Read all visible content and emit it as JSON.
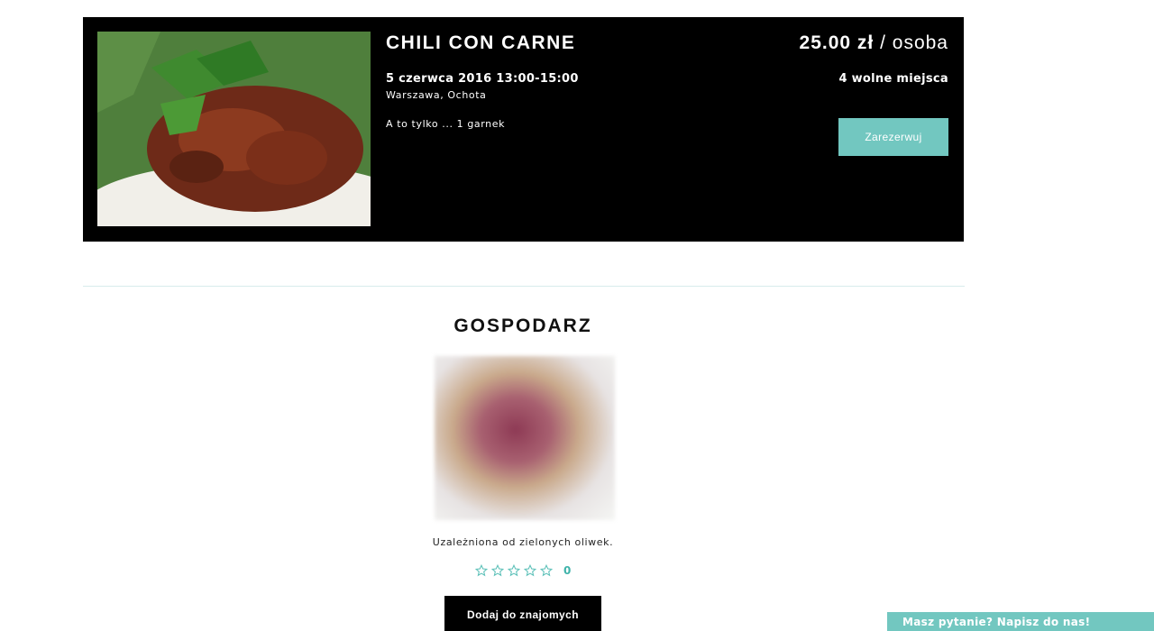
{
  "event": {
    "title": "CHILI CON CARNE",
    "date_time": "5 czerwca 2016 13:00-15:00",
    "location": "Warszawa, Ochota",
    "description": "A to tylko ... 1 garnek",
    "price_amount": "25.00 zł",
    "price_unit": " / osoba",
    "seats": "4 wolne miejsca",
    "reserve_label": "Zarezerwuj",
    "image_icon": "dish-photo"
  },
  "host": {
    "heading": "GOSPODARZ",
    "bio": "Uzależniona od zielonych oliwek.",
    "rating_value": 0,
    "rating_max": 5,
    "rating_count": "0",
    "add_friend_label": "Dodaj do znajomych"
  },
  "chat": {
    "label": "Masz pytanie? Napisz do nas!"
  },
  "colors": {
    "accent": "#72c7c0",
    "card_background": "#000000"
  }
}
